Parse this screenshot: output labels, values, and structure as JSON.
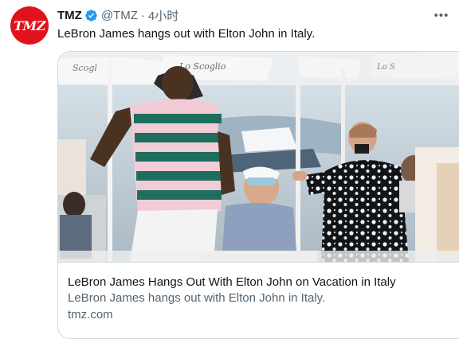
{
  "tweet": {
    "avatar_text": "TMZ",
    "author_name": "TMZ",
    "handle": "@TMZ",
    "separator": "·",
    "time": "4小时",
    "text": "LeBron James hangs out with Elton John in Italy."
  },
  "card": {
    "title": "LeBron James Hangs Out With Elton John on Vacation in Italy",
    "description": "LeBron James hangs out with Elton John in Italy.",
    "domain": "tmz.com",
    "photo_sign_texts": [
      "Scogl",
      "Lo Scoglio",
      "Lo S"
    ]
  },
  "icons": {
    "verified": "verified-badge-icon",
    "more": "more-dots-icon"
  },
  "colors": {
    "avatar_bg": "#e0121b",
    "verified": "#1d9bf0",
    "secondary_text": "#536471",
    "border": "#cfd9de"
  }
}
